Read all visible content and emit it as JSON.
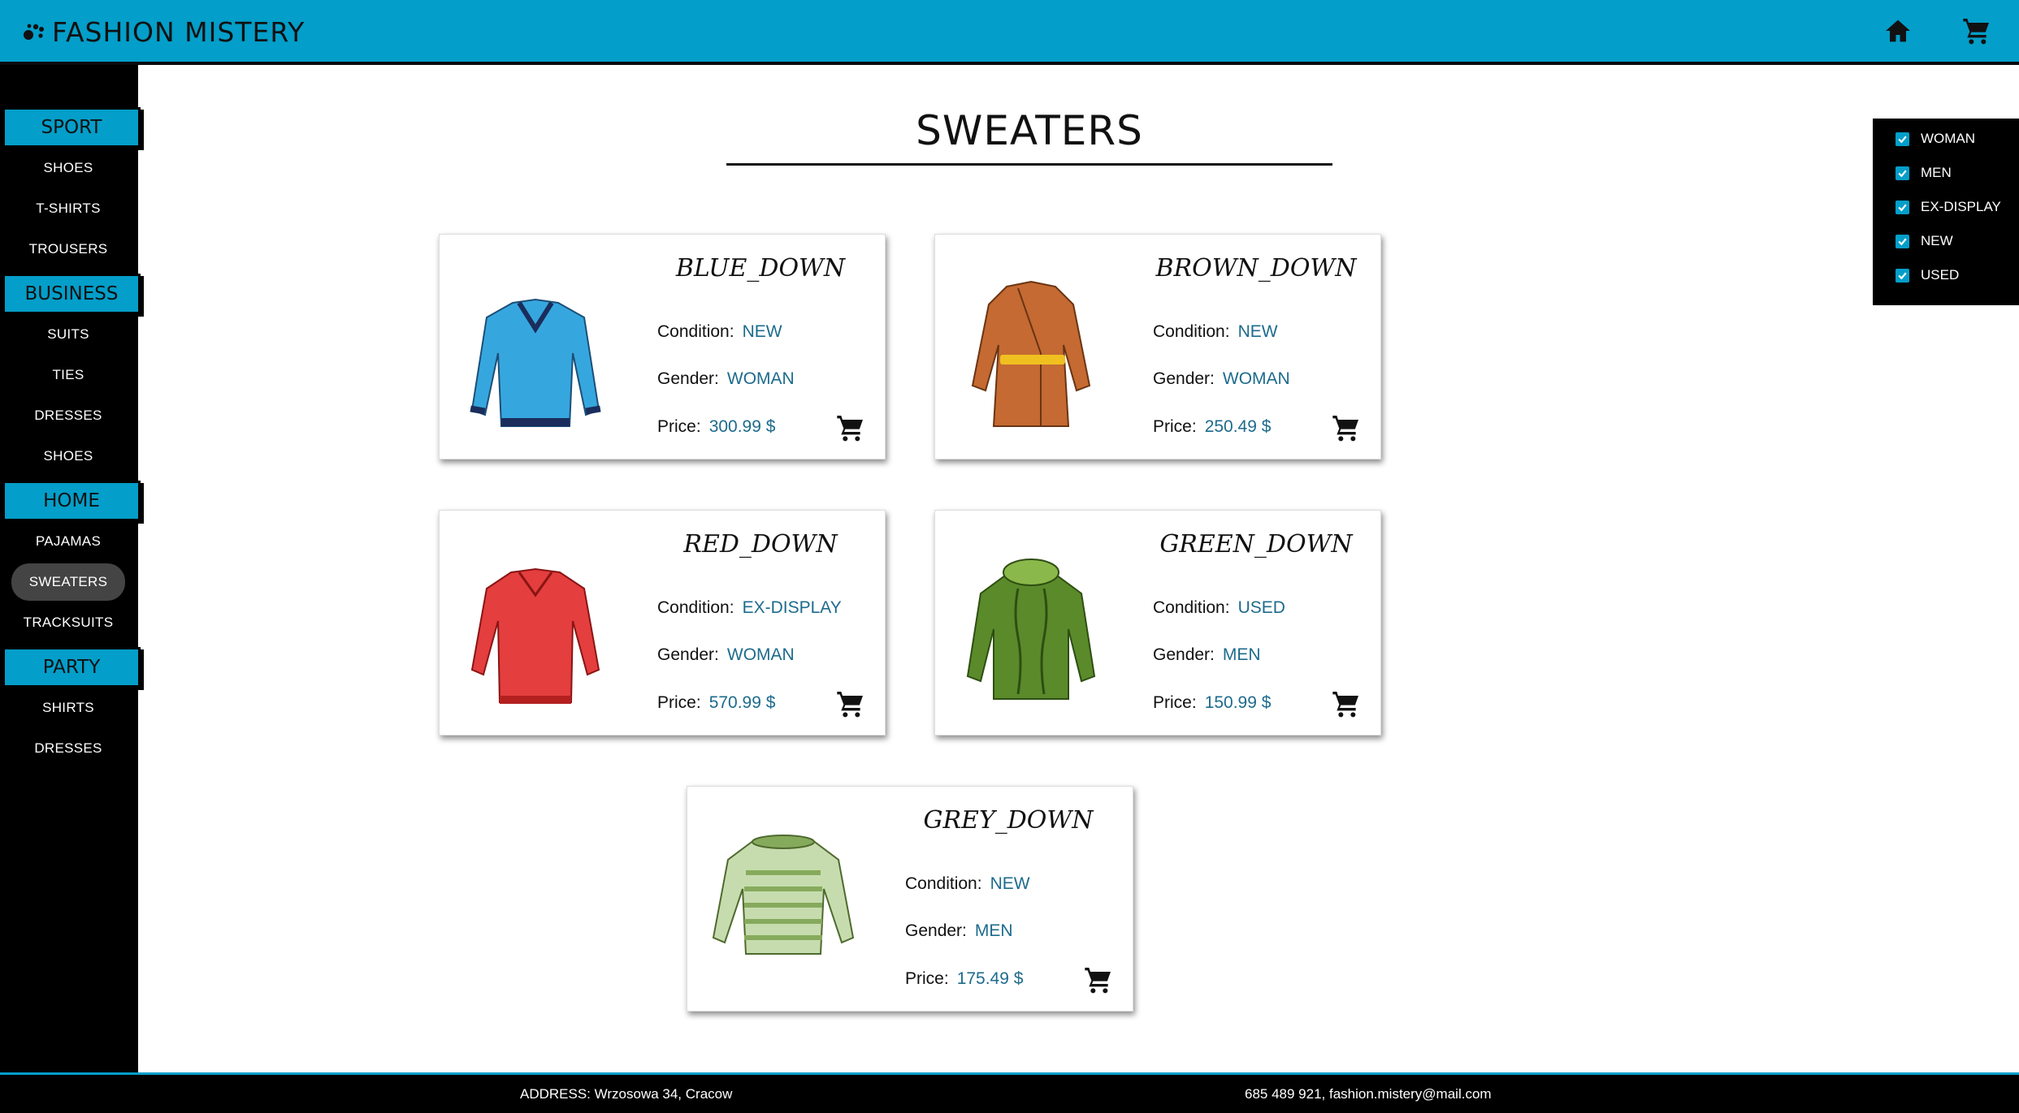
{
  "header": {
    "brand": "FASHION MISTERY",
    "icons": {
      "logo": "paw-icon",
      "home": "home-icon",
      "cart": "cart-icon"
    },
    "colors": {
      "primary": "#039ec9",
      "dark": "#000000",
      "value_text": "#1d6b8c"
    }
  },
  "sidebar": {
    "groups": [
      {
        "label": "SPORT",
        "items": [
          "SHOES",
          "T-SHIRTS",
          "TROUSERS"
        ]
      },
      {
        "label": "BUSINESS",
        "items": [
          "SUITS",
          "TIES",
          "DRESSES",
          "SHOES"
        ]
      },
      {
        "label": "HOME",
        "items": [
          "PAJAMAS",
          "SWEATERS",
          "TRACKSUITS"
        ]
      },
      {
        "label": "PARTY",
        "items": [
          "SHIRTS",
          "DRESSES"
        ]
      }
    ],
    "active_item": "SWEATERS"
  },
  "main": {
    "title": "SWEATERS",
    "labels": {
      "condition": "Condition:",
      "gender": "Gender:",
      "price": "Price:"
    },
    "products": [
      {
        "name": "BLUE_DOWN",
        "condition": "NEW",
        "gender": "WOMAN",
        "price": "300.99 $",
        "icon": "blue-sweater-image"
      },
      {
        "name": "BROWN_DOWN",
        "condition": "NEW",
        "gender": "WOMAN",
        "price": "250.49 $",
        "icon": "brown-coat-image"
      },
      {
        "name": "RED_DOWN",
        "condition": "EX-DISPLAY",
        "gender": "WOMAN",
        "price": "570.99 $",
        "icon": "red-dress-image"
      },
      {
        "name": "GREEN_DOWN",
        "condition": "USED",
        "gender": "MEN",
        "price": "150.99 $",
        "icon": "green-sweater-image"
      },
      {
        "name": "GREY_DOWN",
        "condition": "NEW",
        "gender": "MEN",
        "price": "175.49 $",
        "icon": "striped-sweater-image"
      }
    ]
  },
  "filters": [
    {
      "label": "WOMAN",
      "checked": true
    },
    {
      "label": "MEN",
      "checked": true
    },
    {
      "label": "EX-DISPLAY",
      "checked": true
    },
    {
      "label": "NEW",
      "checked": true
    },
    {
      "label": "USED",
      "checked": true
    }
  ],
  "footer": {
    "address": "ADDRESS: Wrzosowa 34, Cracow",
    "contact": "685 489 921, fashion.mistery@mail.com"
  }
}
